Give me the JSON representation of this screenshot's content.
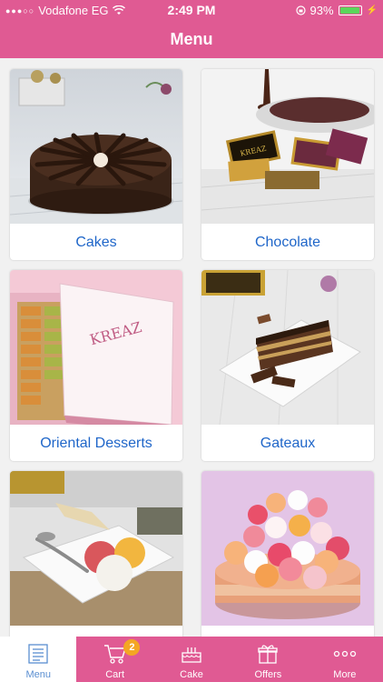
{
  "status_bar": {
    "carrier": "Vodafone EG",
    "time": "2:49 PM",
    "battery": "93%",
    "battery_level": 0.93
  },
  "header": {
    "title": "Menu"
  },
  "categories": [
    {
      "label": "Cakes"
    },
    {
      "label": "Chocolate"
    },
    {
      "label": "Oriental Desserts"
    },
    {
      "label": "Gateaux"
    },
    {
      "label": ""
    },
    {
      "label": ""
    }
  ],
  "tab_bar": {
    "tabs": [
      {
        "label": "Menu",
        "icon": "list-icon",
        "active": true
      },
      {
        "label": "Cart",
        "icon": "cart-icon",
        "badge": "2"
      },
      {
        "label": "Cake",
        "icon": "cake-icon"
      },
      {
        "label": "Offers",
        "icon": "gift-icon"
      },
      {
        "label": "More",
        "icon": "more-icon"
      }
    ]
  },
  "colors": {
    "brand": "#e05a93",
    "label": "#1f66c9",
    "badge": "#f4a623"
  }
}
